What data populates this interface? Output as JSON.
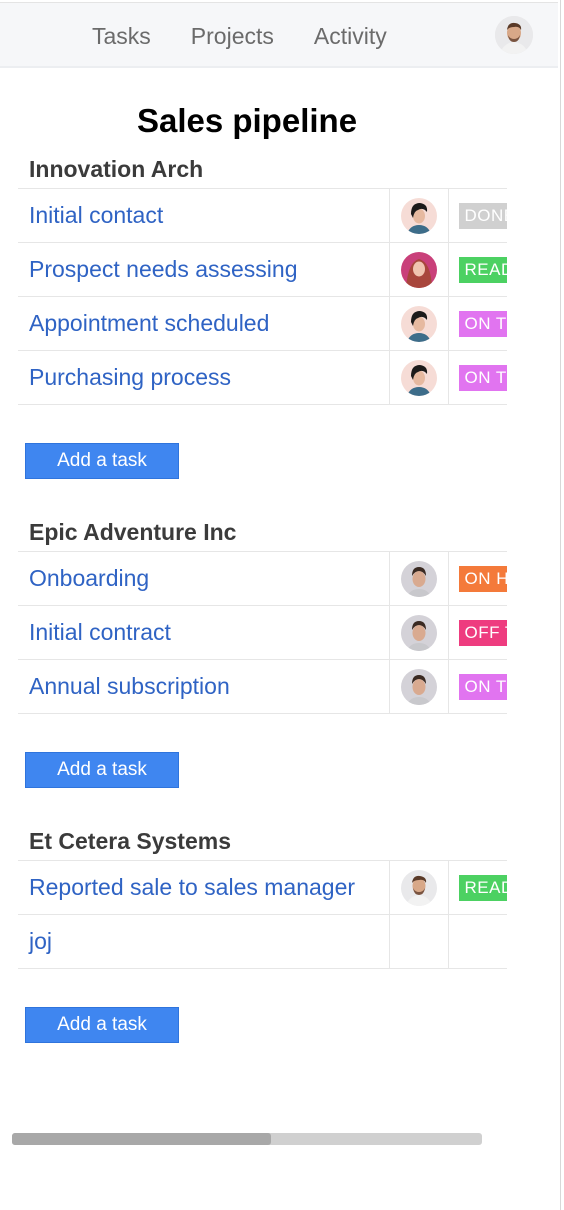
{
  "nav": {
    "items": [
      "Tasks",
      "Projects",
      "Activity"
    ],
    "user_avatar": "user-avatar-man-beard"
  },
  "page": {
    "title": "Sales pipeline"
  },
  "colors": {
    "link": "#2f63c4",
    "button": "#3f86f0",
    "status_done": "#d0d0d0",
    "status_ready": "#4cd162",
    "status_on_track": "#e174f0",
    "status_on_hold": "#f47a3a",
    "status_off_track": "#ee3c7f"
  },
  "groups": [
    {
      "name": "Innovation Arch",
      "add_label": "Add a task",
      "tasks": [
        {
          "name": "Initial contact",
          "owner": "woman-dark-hair",
          "status": "DONE",
          "status_color": "#d0d0d0"
        },
        {
          "name": "Prospect needs assessing",
          "owner": "woman-red-hair",
          "status": "READY",
          "status_color": "#4cd162"
        },
        {
          "name": "Appointment scheduled",
          "owner": "woman-dark-hair",
          "status": "ON TRACK",
          "status_color": "#e174f0"
        },
        {
          "name": "Purchasing process",
          "owner": "woman-dark-hair",
          "status": "ON TRACK",
          "status_color": "#e174f0"
        }
      ]
    },
    {
      "name": "Epic Adventure Inc",
      "add_label": "Add a task",
      "tasks": [
        {
          "name": "Onboarding",
          "owner": "man-short-hair",
          "status": "ON HOLD",
          "status_color": "#f47a3a"
        },
        {
          "name": "Initial contract",
          "owner": "man-short-hair",
          "status": "OFF TRACK",
          "status_color": "#ee3c7f"
        },
        {
          "name": "Annual subscription",
          "owner": "man-short-hair",
          "status": "ON TRACK",
          "status_color": "#e174f0"
        }
      ]
    },
    {
      "name": "Et Cetera Systems",
      "add_label": "Add a task",
      "tasks": [
        {
          "name": "Reported sale to sales manager",
          "owner": "man-beard",
          "status": "READY",
          "status_color": "#4cd162"
        },
        {
          "name": "joj",
          "owner": "",
          "status": "",
          "status_color": ""
        }
      ]
    }
  ],
  "scrollbar": {
    "horizontal_position_fraction": 0.0,
    "visible_fraction": 0.55
  }
}
